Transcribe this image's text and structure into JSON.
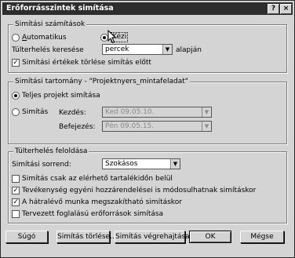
{
  "window": {
    "title": "Erőforrásszintek simítása",
    "help_glyph": "?",
    "close_glyph": "×"
  },
  "mode_group": {
    "legend": "Simítási számítások",
    "automatic_label": "Automatikus",
    "manual_label": "Kézi",
    "manual_selected": true,
    "overload_label": "Túlterhelés keresése",
    "overload_value": "percek",
    "overload_suffix": "alapján",
    "clear_label": "Simítási értékek törlése simítás előtt",
    "clear_checked": true
  },
  "range_group": {
    "legend": "Simítási tartomány - \"Projektnyers_mintafeladat\"",
    "whole_label": "Teljes projekt simítása",
    "whole_selected": true,
    "partial_label": "Simítás",
    "start_label": "Kezdés:",
    "start_value": "Ked 09.05.10.",
    "end_label": "Befejezés:",
    "end_value": "Pén 09.05.15."
  },
  "resolve_group": {
    "legend": "Túlterhelés feloldása",
    "order_label": "Simítási sorrend:",
    "order_value": "Szokásos",
    "options": [
      {
        "label": "Simítás csak az elérhető tartalékidőn belül",
        "checked": false
      },
      {
        "label": "Tevékenység egyéni hozzárendelései is módosulhatnak simításkor",
        "checked": true
      },
      {
        "label": "A hátralévő munka megszakítható simításkor",
        "checked": true
      },
      {
        "label": "Tervezett foglalású erőforrások simítása",
        "checked": false
      }
    ]
  },
  "buttons": {
    "help": "Súgó",
    "clear": "Simítás törlése...",
    "run": "Simítás végrehajtása",
    "ok": "OK",
    "cancel": "Mégse"
  }
}
